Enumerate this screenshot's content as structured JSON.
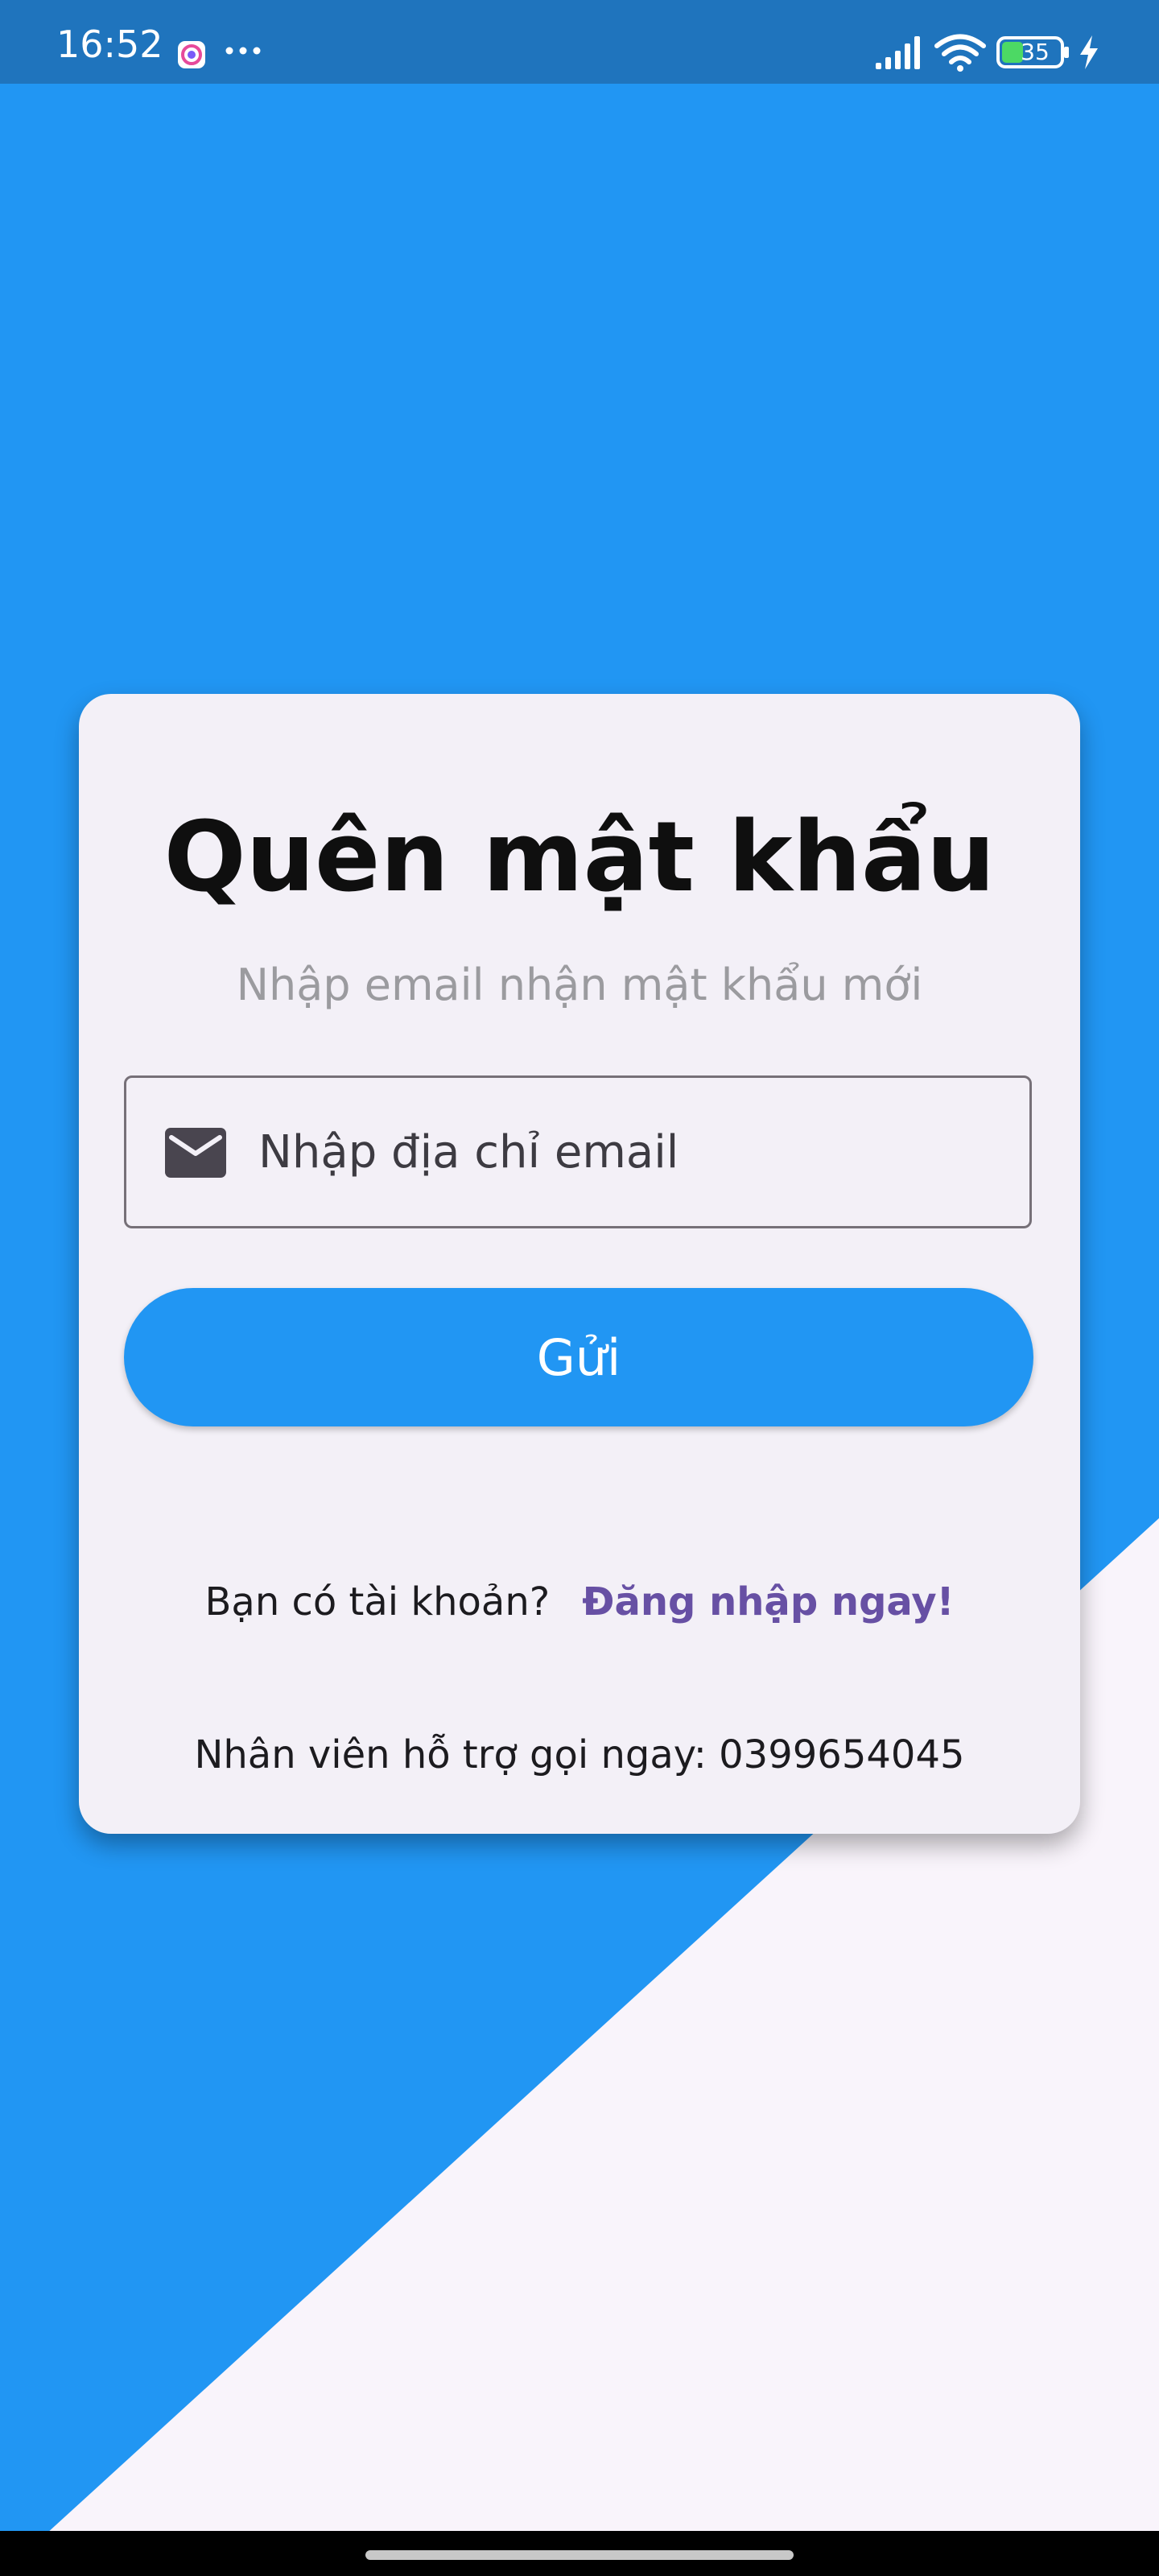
{
  "status_bar": {
    "time": "16:52",
    "battery_level": "35",
    "icons": [
      "app-notification-icon",
      "more-dots-icon",
      "signal-icon",
      "wifi-icon",
      "battery-icon",
      "charging-icon"
    ]
  },
  "colors": {
    "primary": "#2196F3",
    "card_background": "#f3f0f7",
    "link": "#6750a4",
    "bottom_background": "#f9f4fb"
  },
  "forgot_password": {
    "title": "Quên mật khẩu",
    "subtitle": "Nhập email nhận mật khẩu mới",
    "email_placeholder": "Nhập địa chỉ email",
    "email_value": "",
    "send_label": "Gửi",
    "account_question": "Bạn có tài khoản?",
    "login_link": "Đăng nhập ngay!",
    "support_text": "Nhân viên hỗ trợ gọi ngay: 0399654045"
  }
}
